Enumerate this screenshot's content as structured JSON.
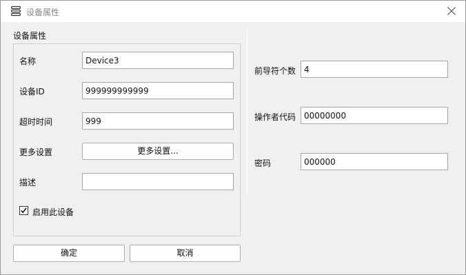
{
  "window": {
    "title": "设备属性"
  },
  "group": {
    "title": "设备属性"
  },
  "left_fields": {
    "name": {
      "label": "名称",
      "value": "Device3"
    },
    "device_id": {
      "label": "设备ID",
      "value": "999999999999"
    },
    "timeout": {
      "label": "超时时间",
      "value": "999"
    },
    "more_settings": {
      "label": "更多设置",
      "button_label": "更多设置..."
    },
    "description": {
      "label": "描述",
      "value": ""
    }
  },
  "enable_device": {
    "label": "启用此设备",
    "checked": true
  },
  "right_fields": {
    "preamble_count": {
      "label": "前导符个数",
      "value": "4"
    },
    "operator_code": {
      "label": "操作者代码",
      "value": "00000000"
    },
    "password": {
      "label": "密码",
      "value": "000000"
    }
  },
  "footer": {
    "ok_label": "确定",
    "cancel_label": "取消"
  },
  "icons": {
    "app": "menu-stack-icon",
    "close": "close-icon",
    "check": "check-icon"
  }
}
